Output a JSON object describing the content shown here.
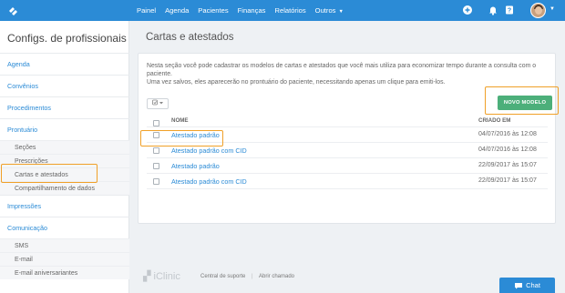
{
  "nav": {
    "items": [
      "Painel",
      "Agenda",
      "Pacientes",
      "Finanças",
      "Relatórios",
      "Outros"
    ],
    "more_caret": "⌄"
  },
  "sidebar": {
    "title": "Configs. de profissionais",
    "sections": {
      "agenda": "Agenda",
      "convenios": "Convênios",
      "procedimentos": "Procedimentos",
      "prontuario": "Prontuário",
      "impressoes": "Impressões",
      "comunicacao": "Comunicação"
    },
    "prontuario_items": [
      "Seções",
      "Prescrições",
      "Cartas e atestados",
      "Compartilhamento de dados"
    ],
    "comunicacao_items": [
      "SMS",
      "E-mail",
      "E-mail aniversariantes"
    ]
  },
  "main": {
    "title": "Cartas e atestados",
    "description_line1": "Nesta seção você pode cadastrar os modelos de cartas e atestados que você mais utiliza para economizar tempo durante a consulta com o paciente.",
    "description_line2": "Uma vez salvos, eles aparecerão no prontuário do paciente, necessitando apenas um clique para emiti-los.",
    "new_button": "NOVO MODELO",
    "table": {
      "col_name": "NOME",
      "col_created": "CRIADO EM",
      "rows": [
        {
          "name": "Atestado padrão",
          "created": "04/07/2016 às 12:08"
        },
        {
          "name": "Atestado padrão com CID",
          "created": "04/07/2016 às 12:08"
        },
        {
          "name": "Atestado padrão",
          "created": "22/09/2017 às 15:07"
        },
        {
          "name": "Atestado padrão com CID",
          "created": "22/09/2017 às 15:07"
        }
      ]
    }
  },
  "footer": {
    "brand": "iClinic",
    "support": "Central de suporte",
    "separator": "|",
    "ticket": "Abrir chamado"
  },
  "chat": {
    "label": "Chat"
  },
  "colors": {
    "primary": "#2b8bd6",
    "success": "#4caf7a",
    "highlight": "#f0a028"
  }
}
